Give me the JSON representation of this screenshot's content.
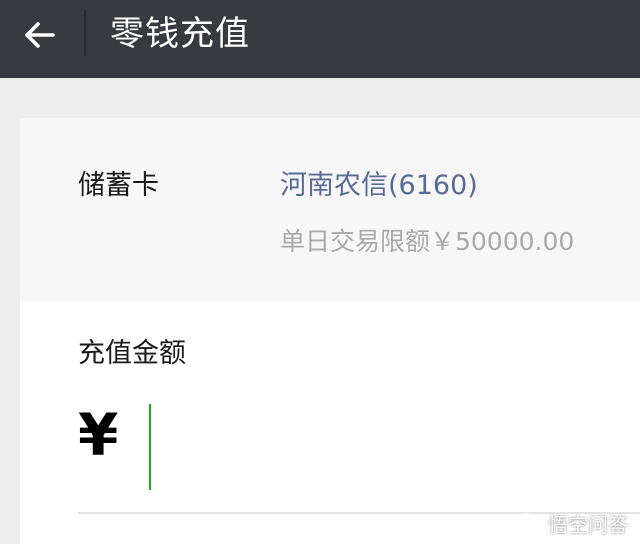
{
  "header": {
    "title": "零钱充值",
    "back_icon": "back-arrow-icon",
    "background": "#393a3f"
  },
  "card": {
    "type_label": "储蓄卡",
    "bank_name": "河南农信(6160)",
    "daily_limit": "单日交易限额￥50000.00",
    "bank_name_color": "#576b95"
  },
  "amount": {
    "label": "充值金额",
    "currency_symbol": "¥",
    "value": "",
    "placeholder": ""
  },
  "watermark": {
    "text": "悟空问答"
  }
}
